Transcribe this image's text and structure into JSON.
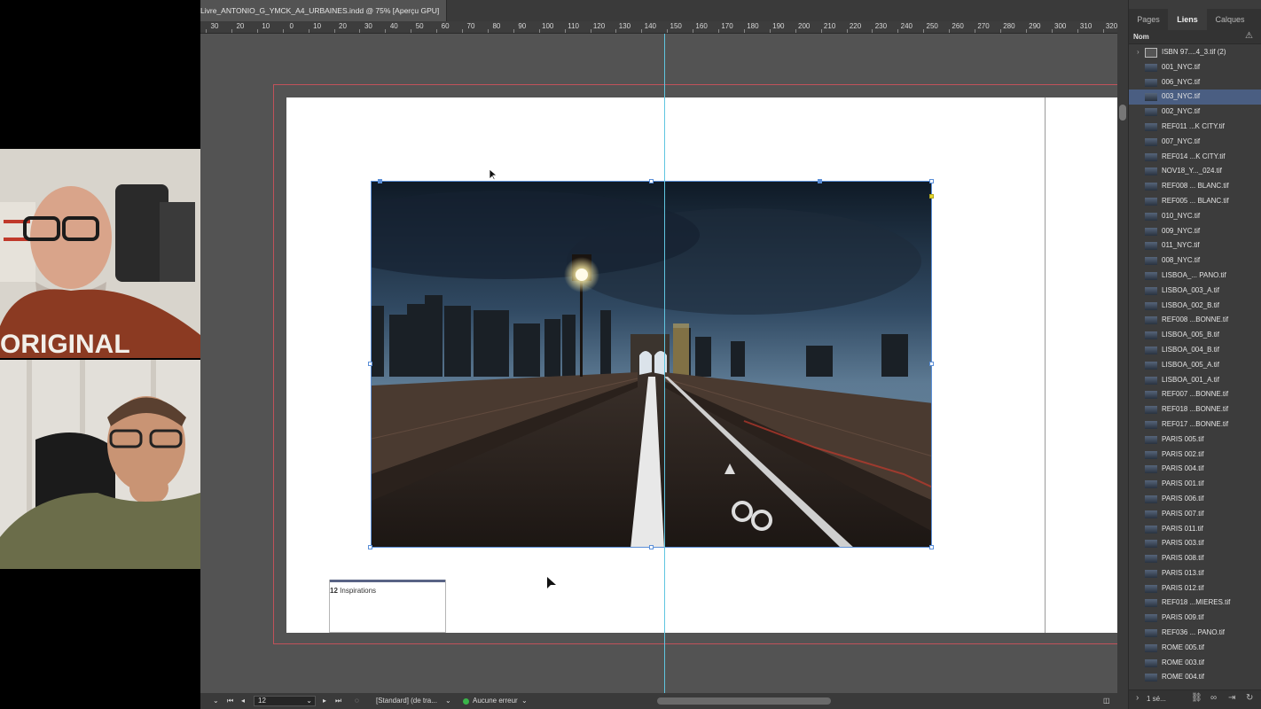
{
  "document": {
    "tab_title": "Livre_ANTONIO_G_YMCK_A4_URBAINES.indd @ 75% [Aperçu GPU]"
  },
  "ruler": {
    "labels": [
      "30",
      "20",
      "10",
      "0",
      "10",
      "20",
      "30",
      "40",
      "50",
      "60",
      "70",
      "80",
      "90",
      "100",
      "110",
      "120",
      "130",
      "140",
      "150",
      "160",
      "170",
      "180",
      "190",
      "200",
      "210",
      "220",
      "230",
      "240",
      "250",
      "260",
      "270",
      "280",
      "290",
      "300",
      "310",
      "320"
    ]
  },
  "page": {
    "caption_number": "12",
    "caption_label": "Inspirations"
  },
  "status": {
    "page_number": "12",
    "style": "[Standard] (de tra...",
    "preflight": "Aucune erreur",
    "colors": {
      "ok": "#3ab54a"
    }
  },
  "panel": {
    "tabs": [
      {
        "label": "Pages"
      },
      {
        "label": "Liens",
        "active": true
      },
      {
        "label": "Calques"
      }
    ],
    "header_label": "Nom",
    "links": [
      {
        "name": "ISBN 97....4_3.tif (2)",
        "group": true
      },
      {
        "name": "001_NYC.tif"
      },
      {
        "name": "006_NYC.tif"
      },
      {
        "name": "003_NYC.tif",
        "selected": true
      },
      {
        "name": "002_NYC.tif"
      },
      {
        "name": "REF011 ...K CITY.tif"
      },
      {
        "name": "007_NYC.tif"
      },
      {
        "name": "REF014 ...K CITY.tif"
      },
      {
        "name": "NOV18_Y..._024.tif"
      },
      {
        "name": "REF008 ... BLANC.tif"
      },
      {
        "name": "REF005 ... BLANC.tif"
      },
      {
        "name": "010_NYC.tif"
      },
      {
        "name": "009_NYC.tif"
      },
      {
        "name": "011_NYC.tif"
      },
      {
        "name": "008_NYC.tif"
      },
      {
        "name": "LISBOA_... PANO.tif"
      },
      {
        "name": "LISBOA_003_A.tif"
      },
      {
        "name": "LISBOA_002_B.tif"
      },
      {
        "name": "REF008 ...BONNE.tif"
      },
      {
        "name": "LISBOA_005_B.tif"
      },
      {
        "name": "LISBOA_004_B.tif"
      },
      {
        "name": "LISBOA_005_A.tif"
      },
      {
        "name": "LISBOA_001_A.tif"
      },
      {
        "name": "REF007 ...BONNE.tif"
      },
      {
        "name": "REF018 ...BONNE.tif"
      },
      {
        "name": "REF017 ...BONNE.tif"
      },
      {
        "name": "PARIS 005.tif"
      },
      {
        "name": "PARIS 002.tif"
      },
      {
        "name": "PARIS 004.tif"
      },
      {
        "name": "PARIS 001.tif"
      },
      {
        "name": "PARIS 006.tif"
      },
      {
        "name": "PARIS 007.tif"
      },
      {
        "name": "PARIS 011.tif"
      },
      {
        "name": "PARIS 003.tif"
      },
      {
        "name": "PARIS 008.tif"
      },
      {
        "name": "PARIS 013.tif"
      },
      {
        "name": "PARIS 012.tif"
      },
      {
        "name": "REF018 ...MIERES.tif"
      },
      {
        "name": "PARIS 009.tif"
      },
      {
        "name": "REF036 ... PANO.tif"
      },
      {
        "name": "ROME 005.tif"
      },
      {
        "name": "ROME 003.tif"
      },
      {
        "name": "ROME 004.tif"
      }
    ],
    "footer_count": "1 sé..."
  },
  "video": {
    "shirt_text": "ORIGINAL"
  }
}
